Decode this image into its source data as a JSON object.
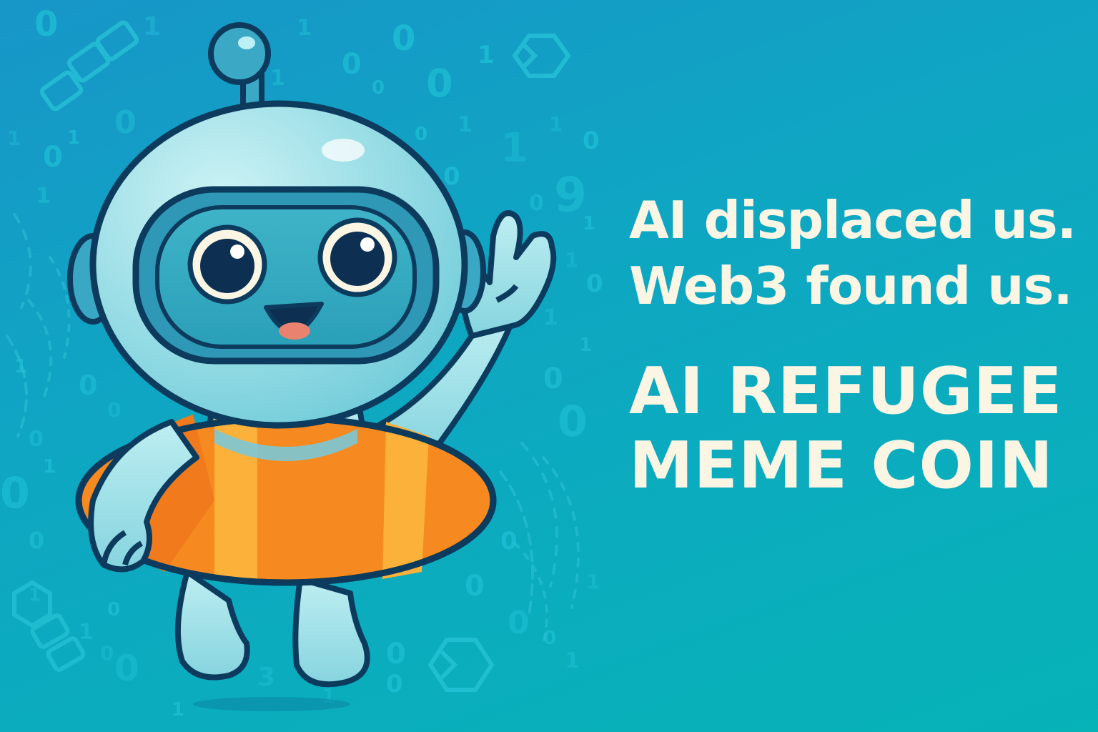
{
  "headline": {
    "tagline_line1": "AI displaced us.",
    "tagline_line2": "Web3 found us.",
    "title_line1": "AI REFUGEE",
    "title_line2": "MEME COIN"
  },
  "colors": {
    "text": "#fbf6e4",
    "robot_body": "#8ad9e2",
    "robot_outline": "#0c3b5e",
    "float_ring_orange": "#f6891f",
    "float_ring_yellow": "#fbb13a"
  },
  "illustration": {
    "character": "robot-astronaut-mascot",
    "accessory": "orange-swim-ring",
    "background_motifs": [
      "binary-digits",
      "chain-link-icons",
      "hexagon-icons"
    ]
  }
}
